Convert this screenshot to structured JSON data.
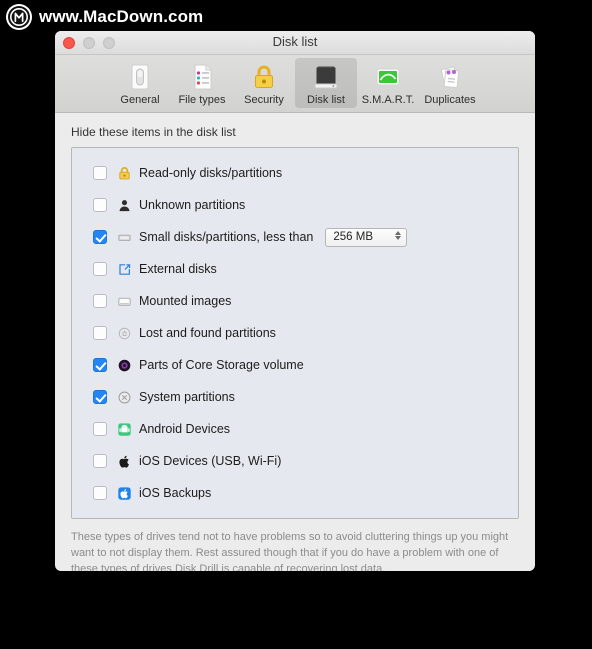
{
  "watermark": {
    "text": "www.MacDown.com",
    "logo_icon": "macdown-m-logo-icon"
  },
  "window": {
    "title": "Disk list",
    "traffic_lights": [
      {
        "name": "close",
        "color": "#f9564c"
      },
      {
        "name": "minimize",
        "color": "#cfcfcf"
      },
      {
        "name": "zoom",
        "color": "#cfcfcf"
      }
    ]
  },
  "toolbar": {
    "tabs": [
      {
        "label": "General",
        "icon": "general-switch-icon",
        "selected": false
      },
      {
        "label": "File types",
        "icon": "file-types-document-icon",
        "selected": false
      },
      {
        "label": "Security",
        "icon": "security-padlock-icon",
        "selected": false
      },
      {
        "label": "Disk list",
        "icon": "disk-list-harddrive-icon",
        "selected": true
      },
      {
        "label": "S.M.A.R.T.",
        "icon": "smart-monitor-icon",
        "selected": false
      },
      {
        "label": "Duplicates",
        "icon": "duplicates-papers-icon",
        "selected": false
      }
    ]
  },
  "main": {
    "section_label": "Hide these items in the disk list",
    "rows": [
      {
        "label": "Read-only disks/partitions",
        "checked": false,
        "icon": "yellow-lock-icon"
      },
      {
        "label": "Unknown partitions",
        "checked": false,
        "icon": "unknown-person-icon"
      },
      {
        "label": "Small disks/partitions, less than",
        "checked": true,
        "icon": "small-disk-icon",
        "has_select": true
      },
      {
        "label": "External disks",
        "checked": false,
        "icon": "external-disk-arrow-icon"
      },
      {
        "label": "Mounted images",
        "checked": false,
        "icon": "mounted-image-icon"
      },
      {
        "label": "Lost and found partitions",
        "checked": false,
        "icon": "lost-found-icon"
      },
      {
        "label": "Parts of Core Storage volume",
        "checked": true,
        "icon": "core-storage-icon"
      },
      {
        "label": "System partitions",
        "checked": true,
        "icon": "system-partition-x-icon"
      },
      {
        "label": "Android Devices",
        "checked": false,
        "icon": "android-robot-icon"
      },
      {
        "label": "iOS Devices (USB, Wi-Fi)",
        "checked": false,
        "icon": "apple-logo-icon"
      },
      {
        "label": "iOS Backups",
        "checked": false,
        "icon": "ios-backup-icon"
      }
    ],
    "size_select": {
      "value": "256 MB"
    },
    "footnote": "These types of drives tend not to have problems so to avoid cluttering things up you might want to not display them. Rest assured though that if you do have a problem with one of these types of drives Disk Drill is capable of recovering lost data."
  },
  "colors": {
    "accent_checkbox": "#2585f5",
    "list_background": "#e5e8ee",
    "window_background": "#ececec"
  }
}
